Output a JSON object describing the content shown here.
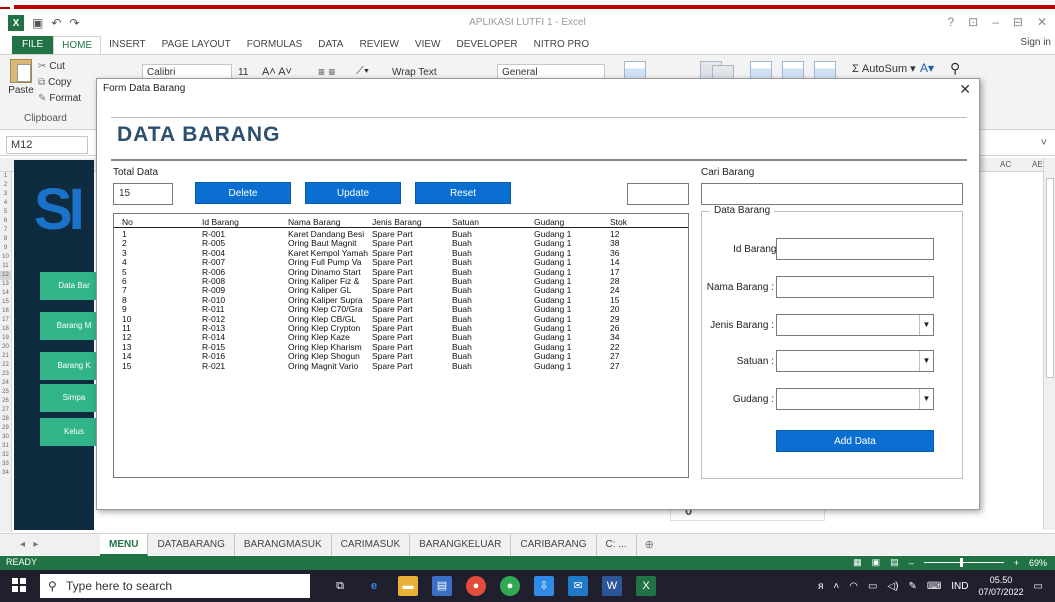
{
  "window": {
    "title": "APLIKASI LUTFI 1 - Excel",
    "controls": [
      "?",
      "⊡",
      "–",
      "⊟",
      "✕"
    ],
    "signin": "Sign in"
  },
  "ribbon": {
    "tabs": [
      "FILE",
      "HOME",
      "INSERT",
      "PAGE LAYOUT",
      "FORMULAS",
      "DATA",
      "REVIEW",
      "VIEW",
      "DEVELOPER",
      "NITRO PRO"
    ],
    "paste": "Paste",
    "cut": "Cut",
    "copy": "Copy",
    "format": "Format",
    "clipboard": "Clipboard",
    "font": "Calibri",
    "font_size": "11",
    "wrap_text": "Wrap Text",
    "number_format": "General",
    "autosum": "AutoSum"
  },
  "formula_bar": {
    "name_box": "M12"
  },
  "sheet": {
    "columns_left": [
      "A",
      "B"
    ],
    "columns_right": [
      "AC",
      "AE"
    ],
    "rows": [
      "1",
      "2",
      "3",
      "4",
      "5",
      "6",
      "7",
      "8",
      "9",
      "10",
      "11",
      "12",
      "13",
      "14",
      "15",
      "16",
      "17",
      "18",
      "19",
      "20",
      "21",
      "22",
      "23",
      "24",
      "25",
      "26",
      "27",
      "28",
      "29",
      "30",
      "31",
      "32",
      "33",
      "34"
    ],
    "logo": "SI",
    "menu_buttons": [
      "Data Bar",
      "Barang M",
      "Barang K",
      "Simpa",
      "Kelus"
    ],
    "bg_value": "0",
    "tabs": [
      "MENU",
      "DATABARANG",
      "BARANGMASUK",
      "CARIMASUK",
      "BARANGKELUAR",
      "CARIBARANG",
      "C: ..."
    ],
    "active_tab": "MENU"
  },
  "status": {
    "ready": "READY",
    "zoom": "69%"
  },
  "taskbar": {
    "search_placeholder": "Type here to search",
    "lang": "IND",
    "time": "05.50",
    "date": "07/07/2022"
  },
  "dialog": {
    "title": "Form Data Barang",
    "heading": "DATA BARANG",
    "total_label": "Total Data",
    "total_value": "15",
    "buttons": {
      "delete": "Delete",
      "update": "Update",
      "reset": "Reset",
      "add": "Add Data"
    },
    "search_label": "Cari Barang",
    "list": {
      "headers": [
        "No",
        "Id Barang",
        "Nama Barang",
        "Jenis Barang",
        "Satuan",
        "Gudang",
        "Stok"
      ],
      "rows": [
        [
          "1",
          "R-001",
          "Karet Dandang Besi",
          "Spare Part",
          "Buah",
          "Gudang 1",
          "12"
        ],
        [
          "2",
          "R-005",
          "Oring Baut Magnit",
          "Spare Part",
          "Buah",
          "Gudang 1",
          "38"
        ],
        [
          "3",
          "R-004",
          "Karet Kempol Yamaha",
          "Spare Part",
          "Buah",
          "Gudang 1",
          "36"
        ],
        [
          "4",
          "R-007",
          "Oring Full Pump Va",
          "Spare Part",
          "Buah",
          "Gudang 1",
          "14"
        ],
        [
          "5",
          "R-006",
          "Oring Dinamo Start",
          "Spare Part",
          "Buah",
          "Gudang 1",
          "17"
        ],
        [
          "6",
          "R-008",
          "Oring Kaliper Fiz &",
          "Spare Part",
          "Buah",
          "Gudang 1",
          "28"
        ],
        [
          "7",
          "R-009",
          "Oring Kaliper GL",
          "Spare Part",
          "Buah",
          "Gudang 1",
          "24"
        ],
        [
          "8",
          "R-010",
          "Oring Kaliper Supra",
          "Spare Part",
          "Buah",
          "Gudang 1",
          "15"
        ],
        [
          "9",
          "R-011",
          "Oring Klep C70/Gra",
          "Spare Part",
          "Buah",
          "Gudang 1",
          "20"
        ],
        [
          "10",
          "R-012",
          "Oring Klep CB/GL",
          "Spare Part",
          "Buah",
          "Gudang 1",
          "29"
        ],
        [
          "11",
          "R-013",
          "Oring Klep Crypton",
          "Spare Part",
          "Buah",
          "Gudang 1",
          "26"
        ],
        [
          "12",
          "R-014",
          "Oring Klep Kaze",
          "Spare Part",
          "Buah",
          "Gudang 1",
          "34"
        ],
        [
          "13",
          "R-015",
          "Oring Klep Kharism",
          "Spare Part",
          "Buah",
          "Gudang 1",
          "22"
        ],
        [
          "14",
          "R-016",
          "Oring Klep Shogun",
          "Spare Part",
          "Buah",
          "Gudang 1",
          "27"
        ],
        [
          "15",
          "R-021",
          "Oring Magnit Vario",
          "Spare Part",
          "Buah",
          "Gudang 1",
          "27"
        ]
      ]
    },
    "frame": {
      "title": "Data Barang",
      "id_label": "Id Barang :",
      "nama_label": "Nama Barang :",
      "jenis_label": "Jenis Barang :",
      "satuan_label": "Satuan :",
      "gudang_label": "Gudang :"
    }
  }
}
